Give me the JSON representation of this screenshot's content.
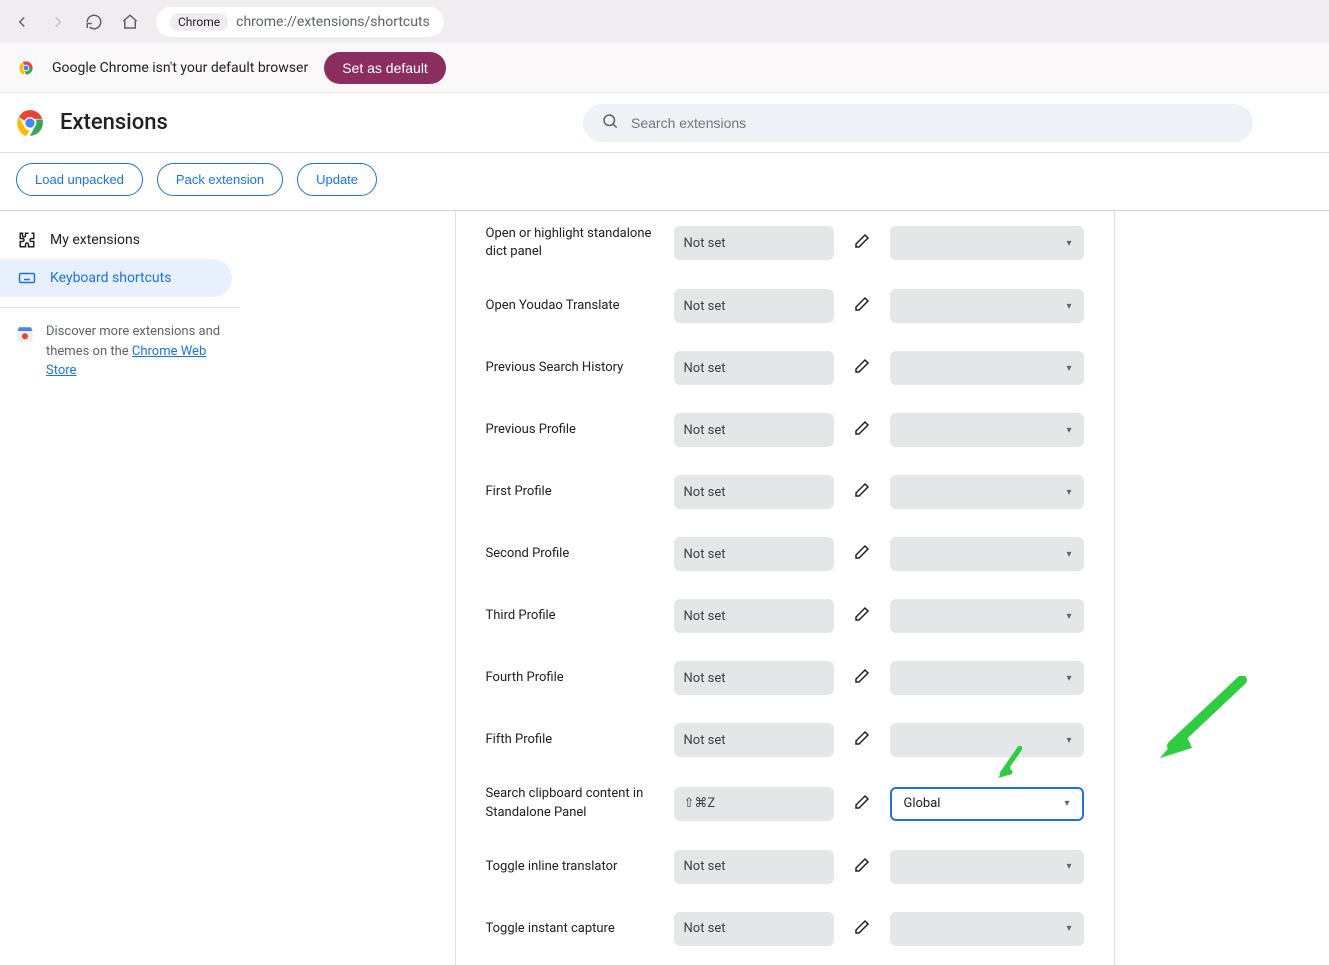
{
  "browser": {
    "url": "chrome://extensions/shortcuts",
    "chrome_label": "Chrome"
  },
  "banner": {
    "text": "Google Chrome isn't your default browser",
    "button": "Set as default"
  },
  "header": {
    "title": "Extensions",
    "search_placeholder": "Search extensions"
  },
  "toolbar": {
    "load_unpacked": "Load unpacked",
    "pack_extension": "Pack extension",
    "update": "Update"
  },
  "sidebar": {
    "my_extensions": "My extensions",
    "keyboard_shortcuts": "Keyboard shortcuts",
    "discover_prefix": "Discover more extensions and themes on the ",
    "store_link": "Chrome Web Store"
  },
  "shortcuts": [
    {
      "label": "Open or highlight standalone dict panel",
      "value": "Not set",
      "scope": "",
      "highlighted": false
    },
    {
      "label": "Open Youdao Translate",
      "value": "Not set",
      "scope": "",
      "highlighted": false
    },
    {
      "label": "Previous Search History",
      "value": "Not set",
      "scope": "",
      "highlighted": false
    },
    {
      "label": "Previous Profile",
      "value": "Not set",
      "scope": "",
      "highlighted": false
    },
    {
      "label": "First Profile",
      "value": "Not set",
      "scope": "",
      "highlighted": false
    },
    {
      "label": "Second Profile",
      "value": "Not set",
      "scope": "",
      "highlighted": false
    },
    {
      "label": "Third Profile",
      "value": "Not set",
      "scope": "",
      "highlighted": false
    },
    {
      "label": "Fourth Profile",
      "value": "Not set",
      "scope": "",
      "highlighted": false
    },
    {
      "label": "Fifth Profile",
      "value": "Not set",
      "scope": "",
      "highlighted": false
    },
    {
      "label": "Search clipboard content in Standalone Panel",
      "value": "⇧⌘Z",
      "scope": "Global",
      "highlighted": true
    },
    {
      "label": "Toggle inline translator",
      "value": "Not set",
      "scope": "",
      "highlighted": false
    },
    {
      "label": "Toggle instant capture",
      "value": "Not set",
      "scope": "",
      "highlighted": false
    }
  ]
}
